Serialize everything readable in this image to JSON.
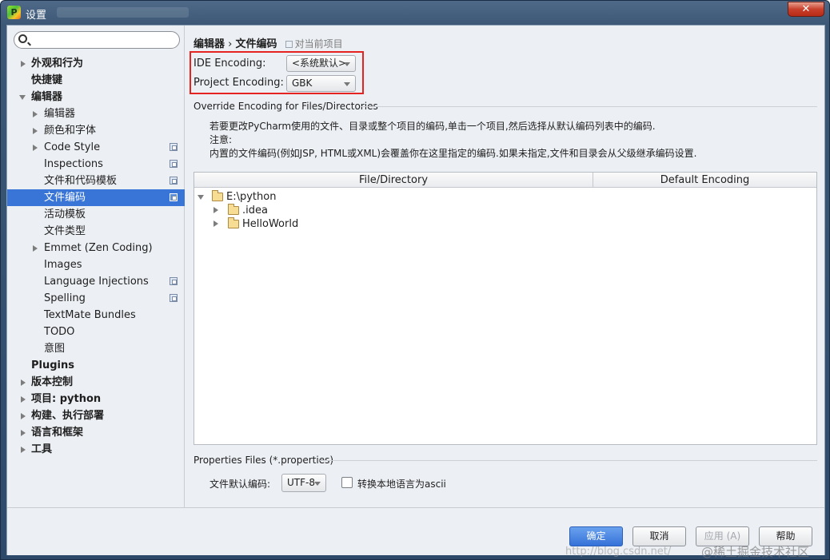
{
  "window": {
    "title": "设置",
    "close_label": "✕"
  },
  "sidebar": {
    "search_placeholder": "",
    "items": [
      {
        "label": "外观和行为",
        "bold": true
      },
      {
        "label": "快捷键",
        "bold": true
      },
      {
        "label": "编辑器",
        "bold": true
      },
      {
        "label": "编辑器"
      },
      {
        "label": "颜色和字体"
      },
      {
        "label": "Code Style"
      },
      {
        "label": "Inspections"
      },
      {
        "label": "文件和代码模板"
      },
      {
        "label": "文件编码"
      },
      {
        "label": "活动模板"
      },
      {
        "label": "文件类型"
      },
      {
        "label": "Emmet (Zen Coding)"
      },
      {
        "label": "Images"
      },
      {
        "label": "Language Injections"
      },
      {
        "label": "Spelling"
      },
      {
        "label": "TextMate Bundles"
      },
      {
        "label": "TODO"
      },
      {
        "label": "意图"
      },
      {
        "label": "Plugins",
        "bold": true
      },
      {
        "label": "版本控制",
        "bold": true
      },
      {
        "label": "项目: python",
        "bold": true
      },
      {
        "label": "构建、执行部署",
        "bold": true
      },
      {
        "label": "语言和框架",
        "bold": true
      },
      {
        "label": "工具",
        "bold": true
      }
    ]
  },
  "breadcrumb": {
    "part1": "编辑器",
    "sep": "›",
    "part2": "文件编码",
    "note": "对当前项目"
  },
  "encoding": {
    "ide_label": "IDE Encoding:",
    "ide_value": "<系统默认>",
    "project_label": "Project Encoding:",
    "project_value": "GBK"
  },
  "override": {
    "title": "Override Encoding for Files/Directories",
    "line1": "若要更改PyCharm使用的文件、目录或整个项目的编码,单击一个项目,然后选择从默认编码列表中的编码.",
    "line2": "注意:",
    "line3": "内置的文件编码(例如JSP, HTML或XML)会覆盖你在这里指定的编码.如果未指定,文件和目录会从父级继承编码设置."
  },
  "table": {
    "col1": "File/Directory",
    "col2": "Default Encoding",
    "rows": [
      {
        "name": "E:\\python",
        "expanded": true
      },
      {
        "name": ".idea"
      },
      {
        "name": "HelloWorld"
      }
    ]
  },
  "properties": {
    "title": "Properties Files (*.properties)",
    "label": "文件默认编码:",
    "value": "UTF-8",
    "checkbox_label": "转换本地语言为ascii"
  },
  "buttons": {
    "ok": "确定",
    "cancel": "取消",
    "apply": "应用 (A)",
    "help": "帮助"
  },
  "watermark": {
    "url": "http://blog.csdn.net/",
    "site": "@稀土掘金技术社区"
  }
}
